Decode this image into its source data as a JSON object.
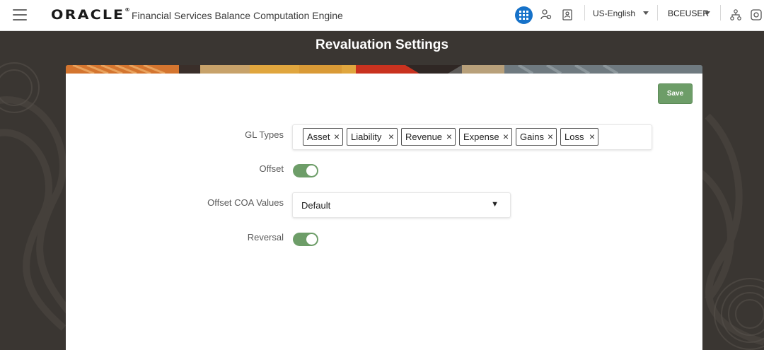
{
  "header": {
    "logo_text": "ORACLE",
    "app_title": "Financial Services Balance Computation Engine",
    "language": "US-English",
    "user": "BCEUSER",
    "icons": [
      "menu-icon",
      "apps-grid-icon",
      "user-role-icon",
      "contacts-icon",
      "hierarchy-icon",
      "help-icon"
    ]
  },
  "page": {
    "title": "Revaluation Settings",
    "save_label": "Save"
  },
  "form": {
    "gl_types_label": "GL Types",
    "gl_types": [
      {
        "label": "Asset"
      },
      {
        "label": "Liability"
      },
      {
        "label": "Revenue"
      },
      {
        "label": "Expense"
      },
      {
        "label": "Gains"
      },
      {
        "label": "Loss"
      }
    ],
    "remove_glyph": "×",
    "offset_label": "Offset",
    "offset_on": true,
    "offset_coa_label": "Offset COA Values",
    "offset_coa_value": "Default",
    "dropdown_glyph": "▼",
    "reversal_label": "Reversal",
    "reversal_on": true
  },
  "colors": {
    "accent_green": "#6d9d68",
    "apps_blue": "#1672c9",
    "page_bg": "#3a3632"
  }
}
